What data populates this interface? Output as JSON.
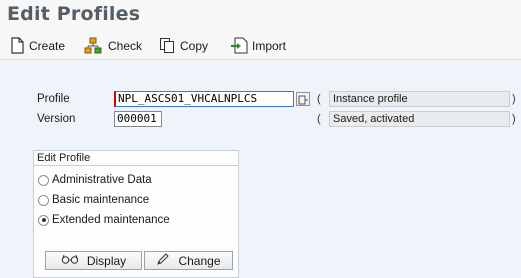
{
  "title": "Edit Profiles",
  "toolbar": {
    "create_label": "Create",
    "check_label": "Check",
    "copy_label": "Copy",
    "import_label": "Import"
  },
  "form": {
    "profile_label": "Profile",
    "profile_value": "NPL_ASCS01_VHCALNPLCS",
    "profile_type": "Instance profile",
    "version_label": "Version",
    "version_value": "000001",
    "version_status": "Saved, activated",
    "open_paren": "(",
    "close_paren": ")"
  },
  "edit_profile": {
    "title": "Edit Profile",
    "options": [
      {
        "label": "Administrative Data",
        "selected": false
      },
      {
        "label": "Basic maintenance",
        "selected": false
      },
      {
        "label": "Extended maintenance",
        "selected": true
      }
    ],
    "display_label": "Display",
    "change_label": "Change"
  },
  "icons": {
    "create": "create-document-icon",
    "check": "check-hierarchy-icon",
    "copy": "copy-icon",
    "import": "import-icon",
    "display": "display-glasses-icon",
    "change": "change-pencil-icon",
    "value_help": "value-help-icon"
  }
}
